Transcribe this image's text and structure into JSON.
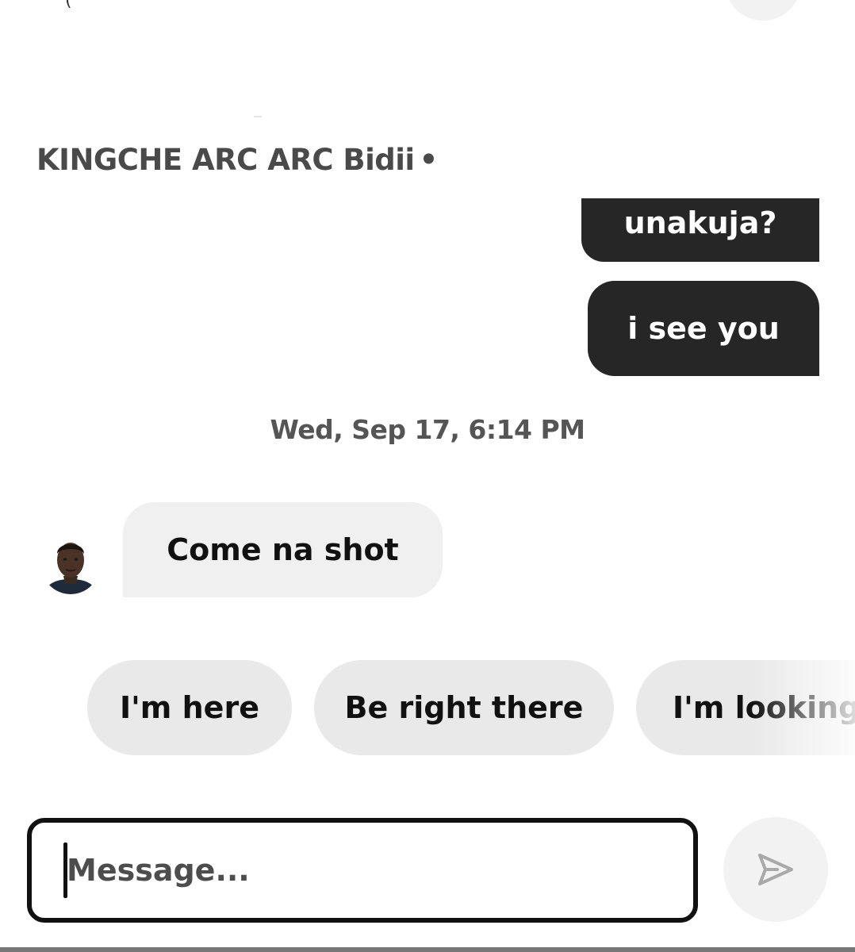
{
  "header": {
    "top_glyph": "(",
    "sender_name": "KINGCHE ARC ARC Bidii",
    "sender_separator": "•"
  },
  "messages": {
    "outgoing": [
      {
        "text": "unakuja?"
      },
      {
        "text": "i see you"
      }
    ],
    "timestamp": "Wed, Sep 17, 6:14 PM",
    "incoming": [
      {
        "text": "Come na shot"
      }
    ]
  },
  "quick_replies": [
    {
      "label": "I'm here"
    },
    {
      "label": "Be right there"
    },
    {
      "label": "I'm looking"
    }
  ],
  "composer": {
    "placeholder": "Message...",
    "value": ""
  },
  "icons": {
    "send": "send-icon",
    "avatar": "avatar"
  },
  "colors": {
    "outgoing_bubble": "#262626",
    "incoming_bubble": "#f0f0f0",
    "chip_background": "#e9e9e9",
    "send_button_bg": "#f2f2f2",
    "text_primary": "#111111",
    "text_secondary": "#555555"
  }
}
